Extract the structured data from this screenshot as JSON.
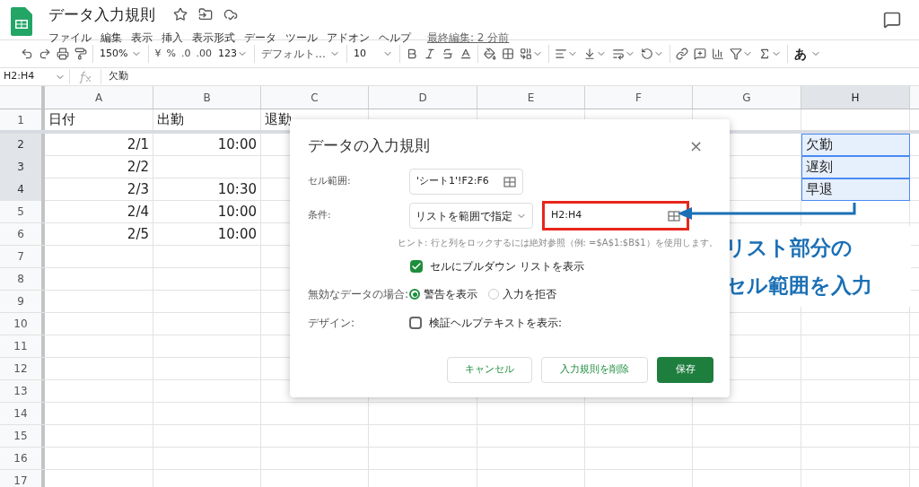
{
  "app": {
    "title": "データ入力規則",
    "last_edit": "最終編集: 2 分前"
  },
  "menu": [
    "ファイル",
    "編集",
    "表示",
    "挿入",
    "表示形式",
    "データ",
    "ツール",
    "アドオン",
    "ヘルプ"
  ],
  "toolbar": {
    "zoom": "150%",
    "currency": "¥",
    "percent": "%",
    "decimal_less": ".0",
    "decimal_more": ".00",
    "number_format": "123",
    "font": "デフォルト…",
    "font_size": "10",
    "input_tool": "あ"
  },
  "formula_bar": {
    "name_box": "H2:H4",
    "value": "欠勤"
  },
  "columns": [
    {
      "label": "A",
      "selected": false
    },
    {
      "label": "B",
      "selected": false
    },
    {
      "label": "C",
      "selected": false
    },
    {
      "label": "D",
      "selected": false
    },
    {
      "label": "E",
      "selected": false
    },
    {
      "label": "F",
      "selected": false
    },
    {
      "label": "G",
      "selected": false
    },
    {
      "label": "H",
      "selected": true
    }
  ],
  "rows": [
    {
      "number": "1",
      "selected": false,
      "cells": {
        "a": {
          "text": "日付",
          "kind": "text",
          "selected": false
        },
        "b": {
          "text": "出勤",
          "kind": "text",
          "selected": false
        },
        "c": {
          "text": "退勤",
          "kind": "text",
          "selected": false
        }
      }
    },
    {
      "number": "2",
      "selected": true,
      "cells": {
        "a": {
          "text": "2/1",
          "kind": "number",
          "selected": false
        },
        "b": {
          "text": "10:00",
          "kind": "number",
          "selected": false
        },
        "h": {
          "text": "欠勤",
          "kind": "text",
          "selected": true
        }
      }
    },
    {
      "number": "3",
      "selected": true,
      "cells": {
        "a": {
          "text": "2/2",
          "kind": "number",
          "selected": false
        },
        "h": {
          "text": "遅刻",
          "kind": "text",
          "selected": true
        }
      }
    },
    {
      "number": "4",
      "selected": true,
      "cells": {
        "a": {
          "text": "2/3",
          "kind": "number",
          "selected": false
        },
        "b": {
          "text": "10:30",
          "kind": "number",
          "selected": false
        },
        "h": {
          "text": "早退",
          "kind": "text",
          "selected": true
        }
      }
    },
    {
      "number": "5",
      "selected": false,
      "cells": {
        "a": {
          "text": "2/4",
          "kind": "number",
          "selected": false
        },
        "b": {
          "text": "10:00",
          "kind": "number",
          "selected": false
        }
      }
    },
    {
      "number": "6",
      "selected": false,
      "cells": {
        "a": {
          "text": "2/5",
          "kind": "number",
          "selected": false
        },
        "b": {
          "text": "10:00",
          "kind": "number",
          "selected": false
        }
      }
    },
    {
      "number": "7",
      "selected": false
    },
    {
      "number": "8",
      "selected": false
    },
    {
      "number": "9",
      "selected": false
    },
    {
      "number": "10",
      "selected": false
    },
    {
      "number": "11",
      "selected": false
    },
    {
      "number": "12",
      "selected": false
    },
    {
      "number": "13",
      "selected": false
    },
    {
      "number": "14",
      "selected": false
    },
    {
      "number": "15",
      "selected": false
    },
    {
      "number": "16",
      "selected": false
    },
    {
      "number": "17",
      "selected": false
    }
  ],
  "dialog": {
    "title": "データの入力規則",
    "close": "×",
    "cell_range": {
      "label": "セル範囲:",
      "value": "'シート1'!F2:F6"
    },
    "criteria": {
      "label": "条件:",
      "type": "リストを範囲で指定",
      "value": "H2:H4",
      "highlighted": true
    },
    "hint": "ヒント: 行と列をロックするには絶対参照（例: =$A$1:$B$1）を使用します。",
    "dropdown_option": {
      "label": "セルにプルダウン リストを表示",
      "checked": true
    },
    "invalid": {
      "label": "無効なデータの場合:",
      "options": [
        {
          "label": "警告を表示",
          "selected": true
        },
        {
          "label": "入力を拒否",
          "selected": false
        }
      ]
    },
    "design": {
      "label": "デザイン:",
      "option": {
        "label": "検証ヘルプテキストを表示:",
        "checked": false
      }
    },
    "buttons": [
      {
        "label": "キャンセル",
        "kind": "secondary"
      },
      {
        "label": "入力規則を削除",
        "kind": "secondary"
      },
      {
        "label": "保存",
        "kind": "primary"
      }
    ]
  },
  "annotation": {
    "lines": [
      "リスト部分の",
      "セル範囲を入力"
    ]
  }
}
